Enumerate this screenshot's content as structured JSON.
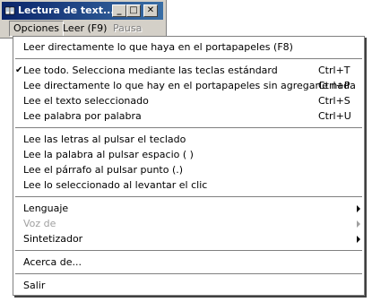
{
  "window": {
    "title": "Lectura de text...",
    "controls": {
      "minimize": "_",
      "maximize": "□",
      "close": "✕"
    }
  },
  "menubar": {
    "items": [
      {
        "label": "Opciones",
        "active": true,
        "enabled": true
      },
      {
        "label": "Leer (F9)",
        "active": false,
        "enabled": true
      },
      {
        "label": "Pausa",
        "active": false,
        "enabled": false
      }
    ]
  },
  "dropdown": {
    "items": [
      {
        "type": "item",
        "label": "Leer directamente lo que haya en el portapapeles (F8)",
        "shortcut": "",
        "checked": false,
        "submenu": false,
        "enabled": true
      },
      {
        "type": "separator"
      },
      {
        "type": "item",
        "label": "Lee todo. Selecciona mediante las teclas estándard",
        "shortcut": "Ctrl+T",
        "checked": true,
        "submenu": false,
        "enabled": true
      },
      {
        "type": "item",
        "label": "Lee directamente lo que hay en el portapapeles sin agregarle nada",
        "shortcut": "Ctrl+P",
        "checked": false,
        "submenu": false,
        "enabled": true
      },
      {
        "type": "item",
        "label": "Lee el texto seleccionado",
        "shortcut": "Ctrl+S",
        "checked": false,
        "submenu": false,
        "enabled": true
      },
      {
        "type": "item",
        "label": "Lee palabra por palabra",
        "shortcut": "Ctrl+U",
        "checked": false,
        "submenu": false,
        "enabled": true
      },
      {
        "type": "separator"
      },
      {
        "type": "item",
        "label": "Lee las letras al pulsar el teclado",
        "shortcut": "",
        "checked": false,
        "submenu": false,
        "enabled": true
      },
      {
        "type": "item",
        "label": "Lee la palabra al pulsar espacio ( )",
        "shortcut": "",
        "checked": false,
        "submenu": false,
        "enabled": true
      },
      {
        "type": "item",
        "label": "Lee el párrafo al pulsar punto (.)",
        "shortcut": "",
        "checked": false,
        "submenu": false,
        "enabled": true
      },
      {
        "type": "item",
        "label": "Lee lo seleccionado al levantar el clic",
        "shortcut": "",
        "checked": false,
        "submenu": false,
        "enabled": true
      },
      {
        "type": "separator"
      },
      {
        "type": "item",
        "label": "Lenguaje",
        "shortcut": "",
        "checked": false,
        "submenu": true,
        "enabled": true
      },
      {
        "type": "item",
        "label": "Voz de",
        "shortcut": "",
        "checked": false,
        "submenu": true,
        "enabled": false
      },
      {
        "type": "item",
        "label": "Sintetizador",
        "shortcut": "",
        "checked": false,
        "submenu": true,
        "enabled": true
      },
      {
        "type": "separator"
      },
      {
        "type": "item",
        "label": "Acerca de...",
        "shortcut": "",
        "checked": false,
        "submenu": false,
        "enabled": true
      },
      {
        "type": "separator"
      },
      {
        "type": "item",
        "label": "Salir",
        "shortcut": "",
        "checked": false,
        "submenu": false,
        "enabled": true
      }
    ]
  },
  "colors": {
    "titlebar_start": "#0a246a",
    "titlebar_end": "#3a6ea5",
    "chrome": "#d4d0c8",
    "menu_bg": "#ffffff",
    "disabled_text": "#a0a0a0"
  },
  "icons": {
    "app": "book-icon",
    "check": "checkmark-icon",
    "submenu": "submenu-arrow-icon"
  }
}
